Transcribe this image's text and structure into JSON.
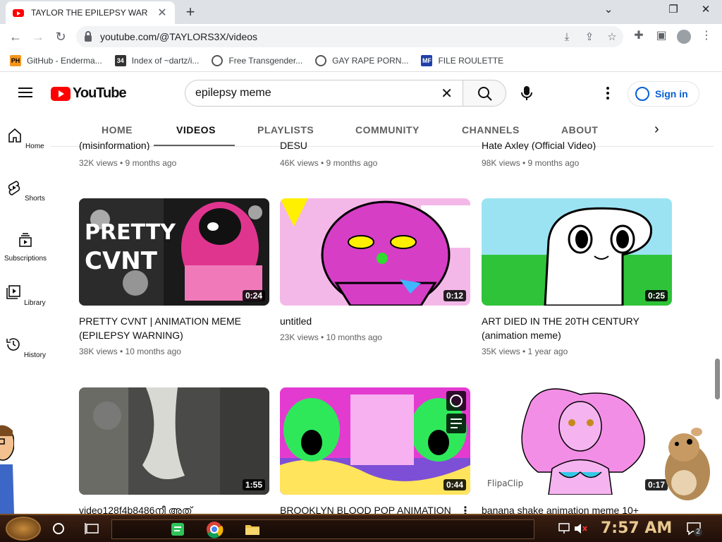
{
  "browser": {
    "tab_title": "TAYLOR THE EPILEPSY WAR",
    "tab_close": "✕",
    "new_tab": "+",
    "url": "youtube.com/@TAYLORS3X/videos",
    "bookmarks": [
      {
        "label": "GitHub - Enderma...",
        "icon_text": "PH",
        "icon_color": "#f7971d"
      },
      {
        "label": "Index of ~dartz/i...",
        "icon_text": "34",
        "icon_color": "#333333"
      },
      {
        "label": "Free Transgender...",
        "icon_text": "",
        "icon_color": "#555555"
      },
      {
        "label": "GAY RAPE PORN...",
        "icon_text": "",
        "icon_color": "#555555"
      },
      {
        "label": "FILE ROULETTE",
        "icon_text": "MF",
        "icon_color": "#1f3fa8"
      }
    ]
  },
  "youtube": {
    "logo_text": "YouTube",
    "search_query": "epilepsy meme",
    "sign_in": "Sign in",
    "channel_tabs": [
      "HOME",
      "VIDEOS",
      "PLAYLISTS",
      "COMMUNITY",
      "CHANNELS",
      "ABOUT"
    ],
    "active_tab": "VIDEOS",
    "rail": [
      {
        "label": "Home",
        "icon": "home-icon"
      },
      {
        "label": "Shorts",
        "icon": "shorts-icon"
      },
      {
        "label": "Subscriptions",
        "icon": "subscriptions-icon"
      },
      {
        "label": "Library",
        "icon": "library-icon"
      },
      {
        "label": "History",
        "icon": "history-icon"
      }
    ],
    "top_row_partial": [
      {
        "title_cut": "(misinformation)",
        "meta": "32K views • 9 months ago"
      },
      {
        "title_cut": "DESU",
        "meta": "46K views • 9 months ago"
      },
      {
        "title_cut": "Hate Axley (Official Video)",
        "meta": "98K views • 9 months ago"
      }
    ],
    "videos": [
      {
        "title": "PRETTY CVNT | ANIMATION MEME (EPILEPSY WARNING)",
        "meta": "38K views • 10 months ago",
        "duration": "0:24"
      },
      {
        "title": "untitled",
        "meta": "23K views • 10 months ago",
        "duration": "0:12"
      },
      {
        "title": "ART DIED IN THE 20TH CENTURY (animation meme)",
        "meta": "35K views • 1 year ago",
        "duration": "0:25"
      },
      {
        "title": "video128f4b8486നീ അത്",
        "meta": "",
        "duration": "1:55"
      },
      {
        "title": "BROOKLYN BLOOD POP ANIMATION",
        "meta": "",
        "duration": "0:44"
      },
      {
        "title": "banana shake animation meme 10+",
        "meta": "",
        "duration": "0:17"
      }
    ]
  },
  "taskbar": {
    "clock": "7:57 AM",
    "notification_count": "2"
  }
}
